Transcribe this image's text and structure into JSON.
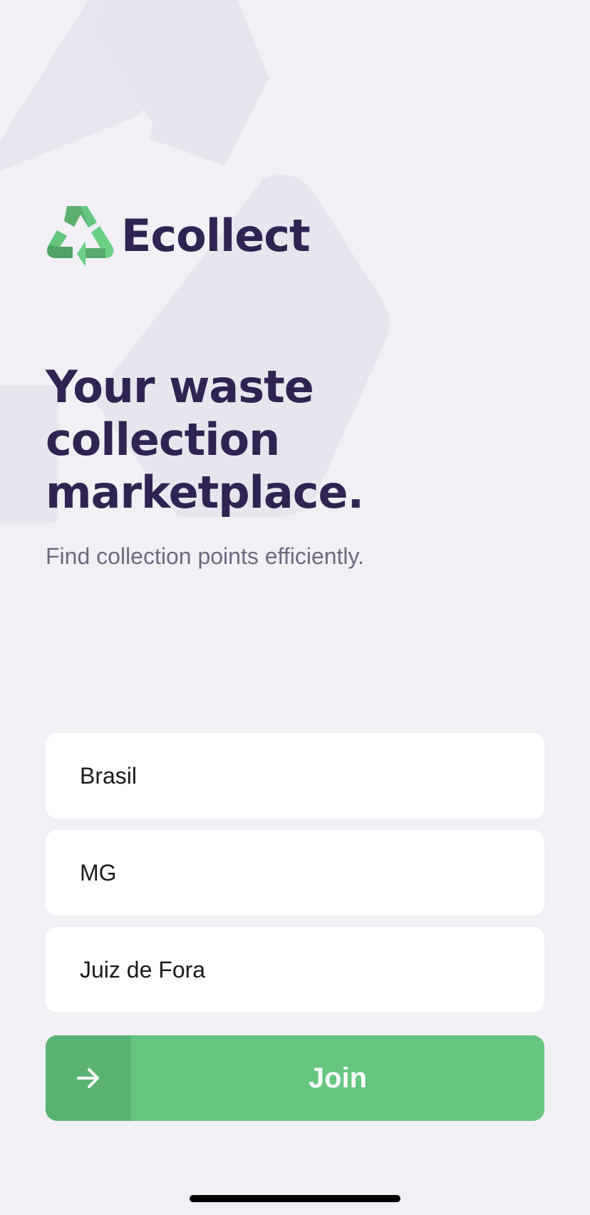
{
  "app": {
    "name": "Ecollect",
    "logo_icon": "recycle-icon"
  },
  "hero": {
    "title_lines": [
      "Your waste",
      "collection",
      "marketplace."
    ],
    "subtitle": "Find collection points efficiently."
  },
  "form": {
    "country": {
      "value": "Brasil"
    },
    "state": {
      "value": "MG"
    },
    "city": {
      "value": "Juiz de Fora"
    },
    "submit": {
      "label": "Join",
      "icon": "arrow-right-icon"
    }
  },
  "colors": {
    "background": "#f0f0f5",
    "brand_text": "#2f2451",
    "subtitle_text": "#6c6c80",
    "accent_green": "#66c67f",
    "accent_green_dark": "#5ab372"
  }
}
